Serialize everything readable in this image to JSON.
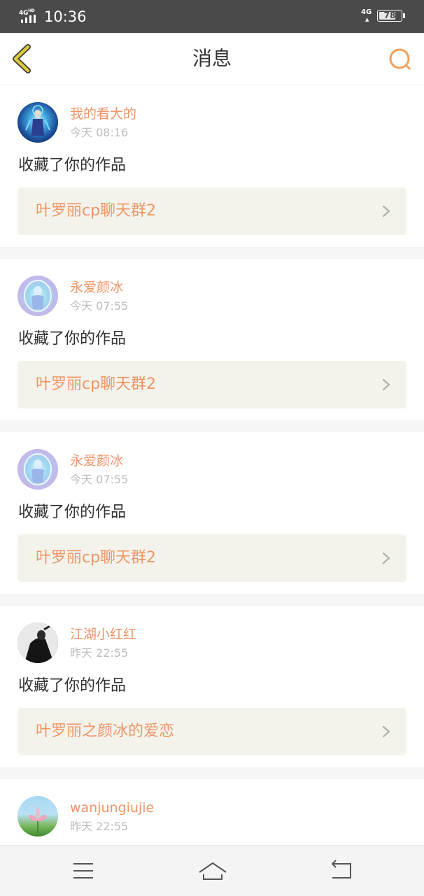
{
  "status_bar": {
    "network_label": "4G HD",
    "time": "10:36",
    "cellular": "4G",
    "battery": "78",
    "battery_level": 0.78
  },
  "header": {
    "title": "消息",
    "back_icon": "chevron-left-icon",
    "search_icon": "search-icon",
    "accent_color": "#f0a05a",
    "back_color": "#c8b23a"
  },
  "notifications": [
    {
      "username": "我的看大的",
      "time": "今天 08:16",
      "action": "收藏了你的作品",
      "work_title": "叶罗丽cp聊天群2"
    },
    {
      "username": "永爱颜冰",
      "time": "今天 07:55",
      "action": "收藏了你的作品",
      "work_title": "叶罗丽cp聊天群2"
    },
    {
      "username": "永爱颜冰",
      "time": "今天 07:55",
      "action": "收藏了你的作品",
      "work_title": "叶罗丽cp聊天群2"
    },
    {
      "username": "江湖小红红",
      "time": "昨天 22:55",
      "action": "收藏了你的作品",
      "work_title": "叶罗丽之颜冰的爱恋"
    },
    {
      "username": "wanjungiujie",
      "time": "昨天 22:55"
    }
  ],
  "colors": {
    "name_orange": "#ee9566",
    "link_bg": "#f3f3ec",
    "status_bar_bg": "#4a4a4a"
  },
  "nav_bar": {
    "menu_icon": "menu-icon",
    "home_icon": "home-icon",
    "back_icon": "back-arrow-icon"
  }
}
